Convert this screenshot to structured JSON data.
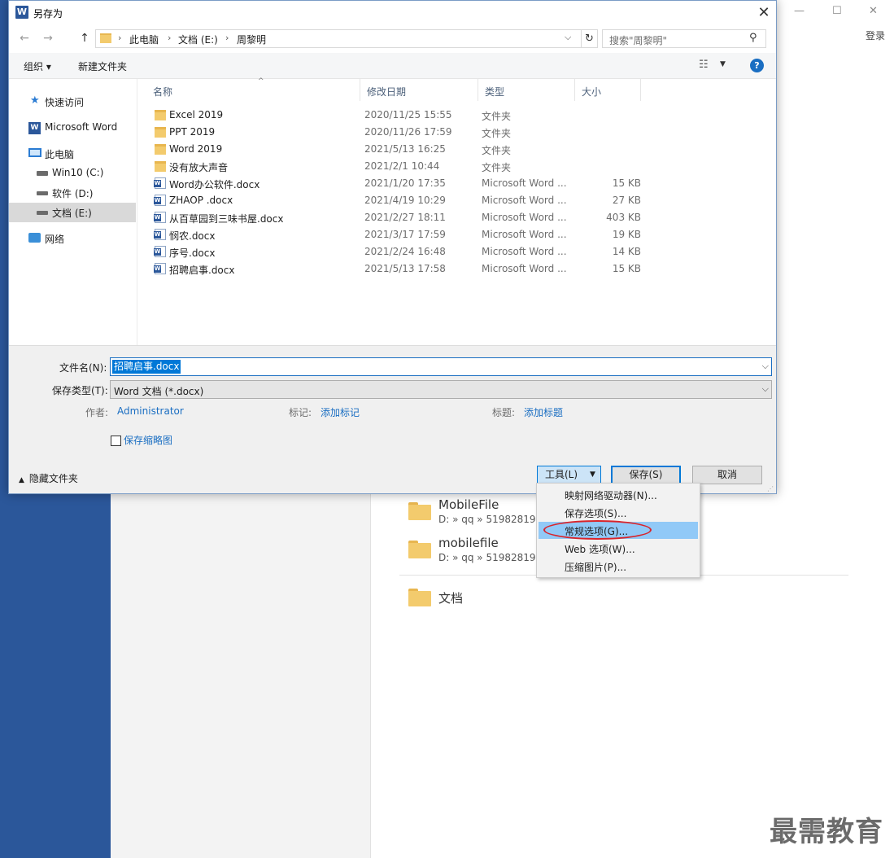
{
  "background": {
    "login": "登录",
    "window_controls": {
      "minimize": "—",
      "maximize": "☐",
      "close": "✕"
    },
    "recent": [
      {
        "title": "MobileFile",
        "path": "D: » qq » 519828197"
      },
      {
        "title": "mobilefile",
        "path": "D: » qq » 519828197"
      }
    ],
    "documents_label": "文档",
    "watermark": "最需教育"
  },
  "dialog": {
    "title": "另存为",
    "title_icon": "W",
    "close_glyph": "✕",
    "nav": {
      "back": "←",
      "forward": "→",
      "up": "↑"
    },
    "breadcrumb": [
      "此电脑",
      "文档 (E:)",
      "周黎明"
    ],
    "breadcrumb_sep": "›",
    "address_dropdown": "⌵",
    "refresh_glyph": "↻",
    "search_placeholder": "搜索\"周黎明\"",
    "search_glyph": "⚲",
    "toolbar": {
      "organize": "组织 ▾",
      "new_folder": "新建文件夹",
      "view_glyph": "☷",
      "view_dropdown": "▼",
      "help": "?"
    },
    "sidebar": [
      {
        "label": "快速访问",
        "icon": "star-icon",
        "glyph": "★"
      },
      {
        "label": "Microsoft Word",
        "icon": "word-icon",
        "glyph": "W"
      },
      {
        "label": "此电脑",
        "icon": "computer-icon"
      },
      {
        "label": "Win10 (C:)",
        "icon": "drive-icon"
      },
      {
        "label": "软件 (D:)",
        "icon": "drive-icon"
      },
      {
        "label": "文档 (E:)",
        "icon": "drive-icon",
        "selected": true
      },
      {
        "label": "网络",
        "icon": "network-icon"
      }
    ],
    "columns": {
      "name": "名称",
      "date": "修改日期",
      "type": "类型",
      "size": "大小",
      "sort_glyph": "^"
    },
    "files": [
      {
        "name": "Excel 2019",
        "date": "2020/11/25 15:55",
        "type": "文件夹",
        "size": "",
        "kind": "folder"
      },
      {
        "name": "PPT 2019",
        "date": "2020/11/26 17:59",
        "type": "文件夹",
        "size": "",
        "kind": "folder"
      },
      {
        "name": "Word 2019",
        "date": "2021/5/13 16:25",
        "type": "文件夹",
        "size": "",
        "kind": "folder"
      },
      {
        "name": "没有放大声音",
        "date": "2021/2/1 10:44",
        "type": "文件夹",
        "size": "",
        "kind": "folder"
      },
      {
        "name": "Word办公软件.docx",
        "date": "2021/1/20 17:35",
        "type": "Microsoft Word ...",
        "size": "15 KB",
        "kind": "doc"
      },
      {
        "name": "ZHAOP .docx",
        "date": "2021/4/19 10:29",
        "type": "Microsoft Word ...",
        "size": "27 KB",
        "kind": "doc"
      },
      {
        "name": "从百草园到三味书屋.docx",
        "date": "2021/2/27 18:11",
        "type": "Microsoft Word ...",
        "size": "403 KB",
        "kind": "doc"
      },
      {
        "name": "悯农.docx",
        "date": "2021/3/17 17:59",
        "type": "Microsoft Word ...",
        "size": "19 KB",
        "kind": "doc"
      },
      {
        "name": "序号.docx",
        "date": "2021/2/24 16:48",
        "type": "Microsoft Word ...",
        "size": "14 KB",
        "kind": "doc"
      },
      {
        "name": "招聘启事.docx",
        "date": "2021/5/13 17:58",
        "type": "Microsoft Word ...",
        "size": "15 KB",
        "kind": "doc"
      }
    ],
    "form": {
      "filename_label": "文件名(N):",
      "filename_value": "招聘启事.docx",
      "filetype_label": "保存类型(T):",
      "filetype_value": "Word 文档 (*.docx)",
      "dropdown_glyph": "⌵",
      "author_label": "作者:",
      "author_value": "Administrator",
      "tags_label": "标记:",
      "tags_value": "添加标记",
      "title_label": "标题:",
      "title_value": "添加标题",
      "thumbnail_label": "保存缩略图",
      "hide_folders": "隐藏文件夹",
      "hide_caret": "▲"
    },
    "buttons": {
      "tools": "工具(L)",
      "tools_arrow": "▼",
      "save": "保存(S)",
      "cancel": "取消",
      "grip": "⋰"
    },
    "tools_menu": [
      {
        "label": "映射网络驱动器(N)..."
      },
      {
        "label": "保存选项(S)..."
      },
      {
        "label": "常规选项(G)...",
        "highlighted": true
      },
      {
        "label": "Web 选项(W)..."
      },
      {
        "label": "压缩图片(P)..."
      }
    ]
  },
  "colors": {
    "word_blue": "#2b579a",
    "accent": "#0078d7",
    "highlight": "#91c9f7",
    "annotation": "#d9242b"
  }
}
